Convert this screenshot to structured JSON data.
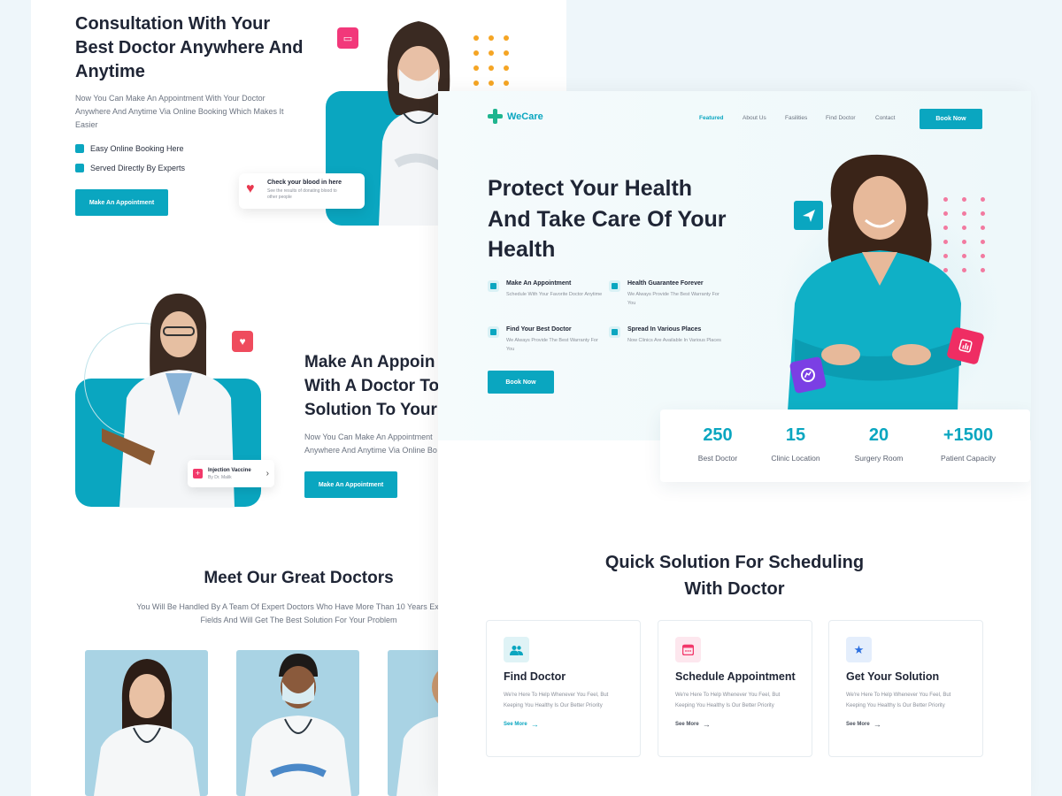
{
  "back": {
    "hero": {
      "title": "Consultation With Your Best Doctor Anywhere And Anytime",
      "desc": "Now You Can Make An Appointment With Your Doctor Anywhere And Anytime Via Online Booking Which Makes It Easier",
      "feature1": "Easy Online Booking Here",
      "feature2": "Served Directly By Experts",
      "button": "Make An Appointment",
      "blood_title": "Check your blood in here",
      "blood_desc": "See the results of donating blood to other people"
    },
    "section2": {
      "title_line1": "Make An Appoin",
      "title_line2": "With A Doctor To",
      "title_line3": "Solution To Your",
      "desc_line1": "Now You Can Make An Appointment",
      "desc_line2": "Anywhere And Anytime Via Online Bo",
      "button": "Make An Appointment",
      "vaccine_title": "Injection Vaccine",
      "vaccine_by": "By Dr. Malik"
    },
    "doctors": {
      "title": "Meet Our Great Doctors",
      "desc_line1": "You Will Be Handled By A Team Of Expert Doctors Who Have More Than 10 Years Experien",
      "desc_line2": "Fields And Will Get The Best Solution For Your Problem"
    }
  },
  "front": {
    "logo": "WeCare",
    "nav": [
      "Featured",
      "About Us",
      "Fasilities",
      "Find Doctor",
      "Contact"
    ],
    "book_button": "Book Now",
    "hero": {
      "title": "Protect Your Health And Take Care Of Your Health",
      "features": [
        {
          "title": "Make An Appointment",
          "desc": "Schedule With Your Favorite Doctor Anytime"
        },
        {
          "title": "Health Guarantee Forever",
          "desc": "We Always Provide The Best Warranty For You"
        },
        {
          "title": "Find Your Best Doctor",
          "desc": "We Always Provide The Best Warranty For You"
        },
        {
          "title": "Spread In Various Places",
          "desc": "Now Clinics Are Available In Various Places"
        }
      ],
      "cta": "Book Now"
    },
    "stats": [
      {
        "value": "250",
        "label": "Best Doctor"
      },
      {
        "value": "15",
        "label": "Clinic Location"
      },
      {
        "value": "20",
        "label": "Surgery Room"
      },
      {
        "value": "+1500",
        "label": "Patient Capacity"
      }
    ],
    "schedule": {
      "title_line1": "Quick Solution For Scheduling",
      "title_line2": "With Doctor",
      "cards": [
        {
          "title": "Find Doctor",
          "desc": "We're Here To Help Whenever You Feel, But Keeping You Healthy Is Our Better Priority",
          "link": "See More",
          "icon_color": "#0aa6c0",
          "icon_bg": "#dff3f6",
          "link_color": "#0aa6c0"
        },
        {
          "title": "Schedule Appointment",
          "desc": "We're Here To Help Whenever You Feel, But Keeping You Healthy Is Our Better Priority",
          "link": "See More",
          "icon_color": "#f2386a",
          "icon_bg": "#fde7ee",
          "link_color": "#4a505c"
        },
        {
          "title": "Get Your Solution",
          "desc": "We're Here To Help Whenever You Feel, But Keeping You Healthy Is Our Better Priority",
          "link": "See More",
          "icon_color": "#2b6fe0",
          "icon_bg": "#e4eefc",
          "link_color": "#4a505c"
        }
      ]
    }
  },
  "colors": {
    "accent": "#0aa6c0",
    "pink": "#f2386a",
    "purple": "#7b3fe4",
    "dark": "#1f2535"
  }
}
